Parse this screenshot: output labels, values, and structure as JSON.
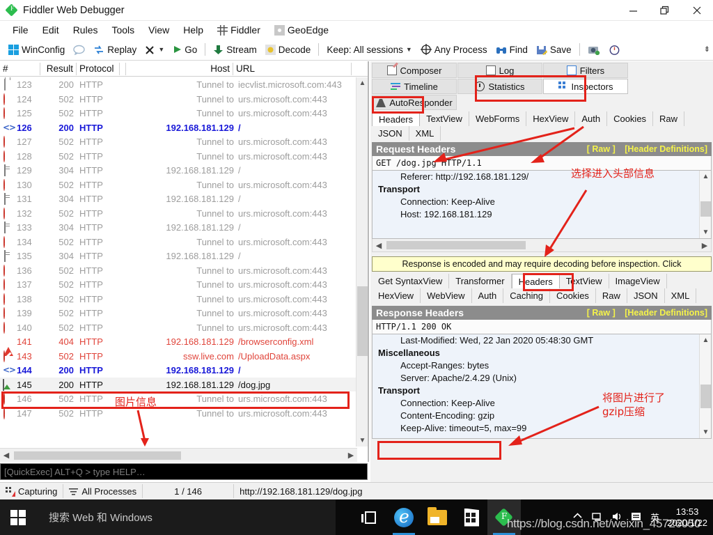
{
  "window": {
    "title": "Fiddler Web Debugger",
    "minimize_label": "Minimize",
    "restore_label": "Restore",
    "close_label": "Close"
  },
  "menu": {
    "items": [
      {
        "label": "File",
        "icon": ""
      },
      {
        "label": "Edit",
        "icon": ""
      },
      {
        "label": "Rules",
        "icon": ""
      },
      {
        "label": "Tools",
        "icon": ""
      },
      {
        "label": "View",
        "icon": ""
      },
      {
        "label": "Help",
        "icon": ""
      },
      {
        "label": "Fiddler",
        "icon": "fiddler-grid-icon"
      },
      {
        "label": "GeoEdge",
        "icon": "geoedge-icon"
      }
    ]
  },
  "toolbar": {
    "winconfig": "WinConfig",
    "comment_icon": "comment-bubble-icon",
    "replay": "Replay",
    "remove": "",
    "go": "Go",
    "stream": "Stream",
    "decode": "Decode",
    "keep": "Keep: All sessions",
    "any_process": "Any Process",
    "find": "Find",
    "save": "Save",
    "capture_icon": "camera-icon",
    "timer_icon": "stopwatch-icon",
    "collapse_icon": "collapse-toolbar-icon"
  },
  "sessions": {
    "columns": [
      "#",
      "Result",
      "Protocol",
      "Host",
      "URL"
    ],
    "rows": [
      {
        "icon": "lock-icon",
        "num": "123",
        "result": "200",
        "protocol": "HTTP",
        "host": "Tunnel to",
        "url": "iecvlist.microsoft.com:443",
        "style": "grey"
      },
      {
        "icon": "block-icon",
        "num": "124",
        "result": "502",
        "protocol": "HTTP",
        "host": "Tunnel to",
        "url": "urs.microsoft.com:443",
        "style": "grey"
      },
      {
        "icon": "block-icon",
        "num": "125",
        "result": "502",
        "protocol": "HTTP",
        "host": "Tunnel to",
        "url": "urs.microsoft.com:443",
        "style": "grey"
      },
      {
        "icon": "code-icon",
        "num": "126",
        "result": "200",
        "protocol": "HTTP",
        "host": "192.168.181.129",
        "url": "/",
        "style": "blue"
      },
      {
        "icon": "block-icon",
        "num": "127",
        "result": "502",
        "protocol": "HTTP",
        "host": "Tunnel to",
        "url": "urs.microsoft.com:443",
        "style": "grey"
      },
      {
        "icon": "block-icon",
        "num": "128",
        "result": "502",
        "protocol": "HTTP",
        "host": "Tunnel to",
        "url": "urs.microsoft.com:443",
        "style": "grey"
      },
      {
        "icon": "doc-icon",
        "num": "129",
        "result": "304",
        "protocol": "HTTP",
        "host": "192.168.181.129",
        "url": "/",
        "style": "grey"
      },
      {
        "icon": "block-icon",
        "num": "130",
        "result": "502",
        "protocol": "HTTP",
        "host": "Tunnel to",
        "url": "urs.microsoft.com:443",
        "style": "grey"
      },
      {
        "icon": "doc-icon",
        "num": "131",
        "result": "304",
        "protocol": "HTTP",
        "host": "192.168.181.129",
        "url": "/",
        "style": "grey"
      },
      {
        "icon": "block-icon",
        "num": "132",
        "result": "502",
        "protocol": "HTTP",
        "host": "Tunnel to",
        "url": "urs.microsoft.com:443",
        "style": "grey"
      },
      {
        "icon": "doc-icon",
        "num": "133",
        "result": "304",
        "protocol": "HTTP",
        "host": "192.168.181.129",
        "url": "/",
        "style": "grey"
      },
      {
        "icon": "block-icon",
        "num": "134",
        "result": "502",
        "protocol": "HTTP",
        "host": "Tunnel to",
        "url": "urs.microsoft.com:443",
        "style": "grey"
      },
      {
        "icon": "doc-icon",
        "num": "135",
        "result": "304",
        "protocol": "HTTP",
        "host": "192.168.181.129",
        "url": "/",
        "style": "grey"
      },
      {
        "icon": "block-icon",
        "num": "136",
        "result": "502",
        "protocol": "HTTP",
        "host": "Tunnel to",
        "url": "urs.microsoft.com:443",
        "style": "grey"
      },
      {
        "icon": "block-icon",
        "num": "137",
        "result": "502",
        "protocol": "HTTP",
        "host": "Tunnel to",
        "url": "urs.microsoft.com:443",
        "style": "grey"
      },
      {
        "icon": "block-icon",
        "num": "138",
        "result": "502",
        "protocol": "HTTP",
        "host": "Tunnel to",
        "url": "urs.microsoft.com:443",
        "style": "grey"
      },
      {
        "icon": "block-icon",
        "num": "139",
        "result": "502",
        "protocol": "HTTP",
        "host": "Tunnel to",
        "url": "urs.microsoft.com:443",
        "style": "grey"
      },
      {
        "icon": "block-icon",
        "num": "140",
        "result": "502",
        "protocol": "HTTP",
        "host": "Tunnel to",
        "url": "urs.microsoft.com:443",
        "style": "grey"
      },
      {
        "icon": "warning-icon",
        "num": "141",
        "result": "404",
        "protocol": "HTTP",
        "host": "192.168.181.129",
        "url": "/browserconfig.xml",
        "style": "red"
      },
      {
        "icon": "block-icon",
        "num": "143",
        "result": "502",
        "protocol": "HTTP",
        "host": "ssw.live.com",
        "url": "/UploadData.aspx",
        "style": "red"
      },
      {
        "icon": "code-icon",
        "num": "144",
        "result": "200",
        "protocol": "HTTP",
        "host": "192.168.181.129",
        "url": "/",
        "style": "blue"
      },
      {
        "icon": "image-icon",
        "num": "145",
        "result": "200",
        "protocol": "HTTP",
        "host": "192.168.181.129",
        "url": "/dog.jpg",
        "style": "dark",
        "selected": true
      },
      {
        "icon": "block-icon",
        "num": "146",
        "result": "502",
        "protocol": "HTTP",
        "host": "Tunnel to",
        "url": "urs.microsoft.com:443",
        "style": "grey"
      },
      {
        "icon": "block-icon",
        "num": "147",
        "result": "502",
        "protocol": "HTTP",
        "host": "Tunnel to",
        "url": "urs.microsoft.com:443",
        "style": "grey"
      }
    ]
  },
  "quickexec": {
    "placeholder": "[QuickExec] ALT+Q > type HELP…"
  },
  "statusbar": {
    "capturing": "Capturing",
    "processes": "All Processes",
    "counter": "1 / 146",
    "url": "http://192.168.181.129/dog.jpg"
  },
  "inspector": {
    "top_tabs": [
      {
        "label": "Composer",
        "icon": "composer-icon",
        "active": false
      },
      {
        "label": "Log",
        "icon": "log-icon",
        "active": false
      },
      {
        "label": "Filters",
        "icon": "filters-icon",
        "active": false
      },
      {
        "label": "Timeline",
        "icon": "timeline-icon",
        "active": false
      },
      {
        "label": "Statistics",
        "icon": "statistics-icon",
        "active": false
      },
      {
        "label": "Inspectors",
        "icon": "inspectors-icon",
        "active": true
      },
      {
        "label": "AutoResponder",
        "icon": "autoresponder-icon",
        "active": false
      }
    ],
    "request_tabs": [
      {
        "label": "Headers",
        "active": true
      },
      {
        "label": "TextView",
        "active": false
      },
      {
        "label": "WebForms",
        "active": false
      },
      {
        "label": "HexView",
        "active": false
      },
      {
        "label": "Auth",
        "active": false
      },
      {
        "label": "Cookies",
        "active": false
      },
      {
        "label": "Raw",
        "active": false
      },
      {
        "label": "JSON",
        "active": false
      },
      {
        "label": "XML",
        "active": false
      }
    ],
    "request": {
      "title": "Request Headers",
      "link_raw": "[ Raw ]",
      "link_defs": "[Header Definitions]",
      "request_line": "GET /dog.jpg HTTP/1.1",
      "lines": [
        {
          "text": "Referer: http://192.168.181.129/",
          "group": false
        },
        {
          "text": "Transport",
          "group": true
        },
        {
          "text": "Connection: Keep-Alive",
          "group": false
        },
        {
          "text": "Host: 192.168.181.129",
          "group": false
        }
      ]
    },
    "notice": "Response is encoded and may require decoding before inspection. Click",
    "response_tabs": [
      {
        "label": "Get SyntaxView",
        "active": false
      },
      {
        "label": "Transformer",
        "active": false
      },
      {
        "label": "Headers",
        "active": true
      },
      {
        "label": "TextView",
        "active": false
      },
      {
        "label": "ImageView",
        "active": false
      },
      {
        "label": "HexView",
        "active": false
      },
      {
        "label": "WebView",
        "active": false
      },
      {
        "label": "Auth",
        "active": false
      },
      {
        "label": "Caching",
        "active": false
      },
      {
        "label": "Cookies",
        "active": false
      },
      {
        "label": "Raw",
        "active": false
      },
      {
        "label": "JSON",
        "active": false
      },
      {
        "label": "XML",
        "active": false
      }
    ],
    "response": {
      "title": "Response Headers",
      "link_raw": "[ Raw ]",
      "link_defs": "[Header Definitions]",
      "status_line": "HTTP/1.1 200 OK",
      "lines": [
        {
          "text": "Last-Modified: Wed, 22 Jan 2020 05:48:30 GMT",
          "group": false
        },
        {
          "text": "Miscellaneous",
          "group": true
        },
        {
          "text": "Accept-Ranges: bytes",
          "group": false
        },
        {
          "text": "Server: Apache/2.4.29 (Unix)",
          "group": false
        },
        {
          "text": "Transport",
          "group": true
        },
        {
          "text": "Connection: Keep-Alive",
          "group": false
        },
        {
          "text": "Content-Encoding: gzip",
          "group": false
        },
        {
          "text": "Keep-Alive: timeout=5, max=99",
          "group": false
        }
      ]
    }
  },
  "annotations": [
    {
      "id": "image-info",
      "text": "图片信息"
    },
    {
      "id": "choose-headers",
      "text": "选择进入头部信息"
    },
    {
      "id": "gzip-note-line1",
      "text": "将图片进行了"
    },
    {
      "id": "gzip-note-line2",
      "text": "gzip压缩"
    }
  ],
  "taskbar": {
    "search_placeholder": "搜索 Web 和 Windows",
    "apps": [
      {
        "name": "task-view-icon"
      },
      {
        "name": "edge-icon"
      },
      {
        "name": "file-explorer-icon"
      },
      {
        "name": "store-icon"
      },
      {
        "name": "fiddler-icon"
      }
    ],
    "tray": [
      "show-hidden-icon",
      "network-icon",
      "volume-icon",
      "action-center-icon"
    ],
    "ime": "英",
    "time": "13:53",
    "date": "2020/1/22"
  },
  "watermark": {
    "text": "https://blog.csdn.net/weixin_45726050"
  },
  "colors": {
    "accent_red": "#e3221a",
    "link_yellow": "#f5f34a",
    "header_grey": "#8c8c8c",
    "notice_yellow": "#ffffcc",
    "blue_row": "#1818d8"
  }
}
